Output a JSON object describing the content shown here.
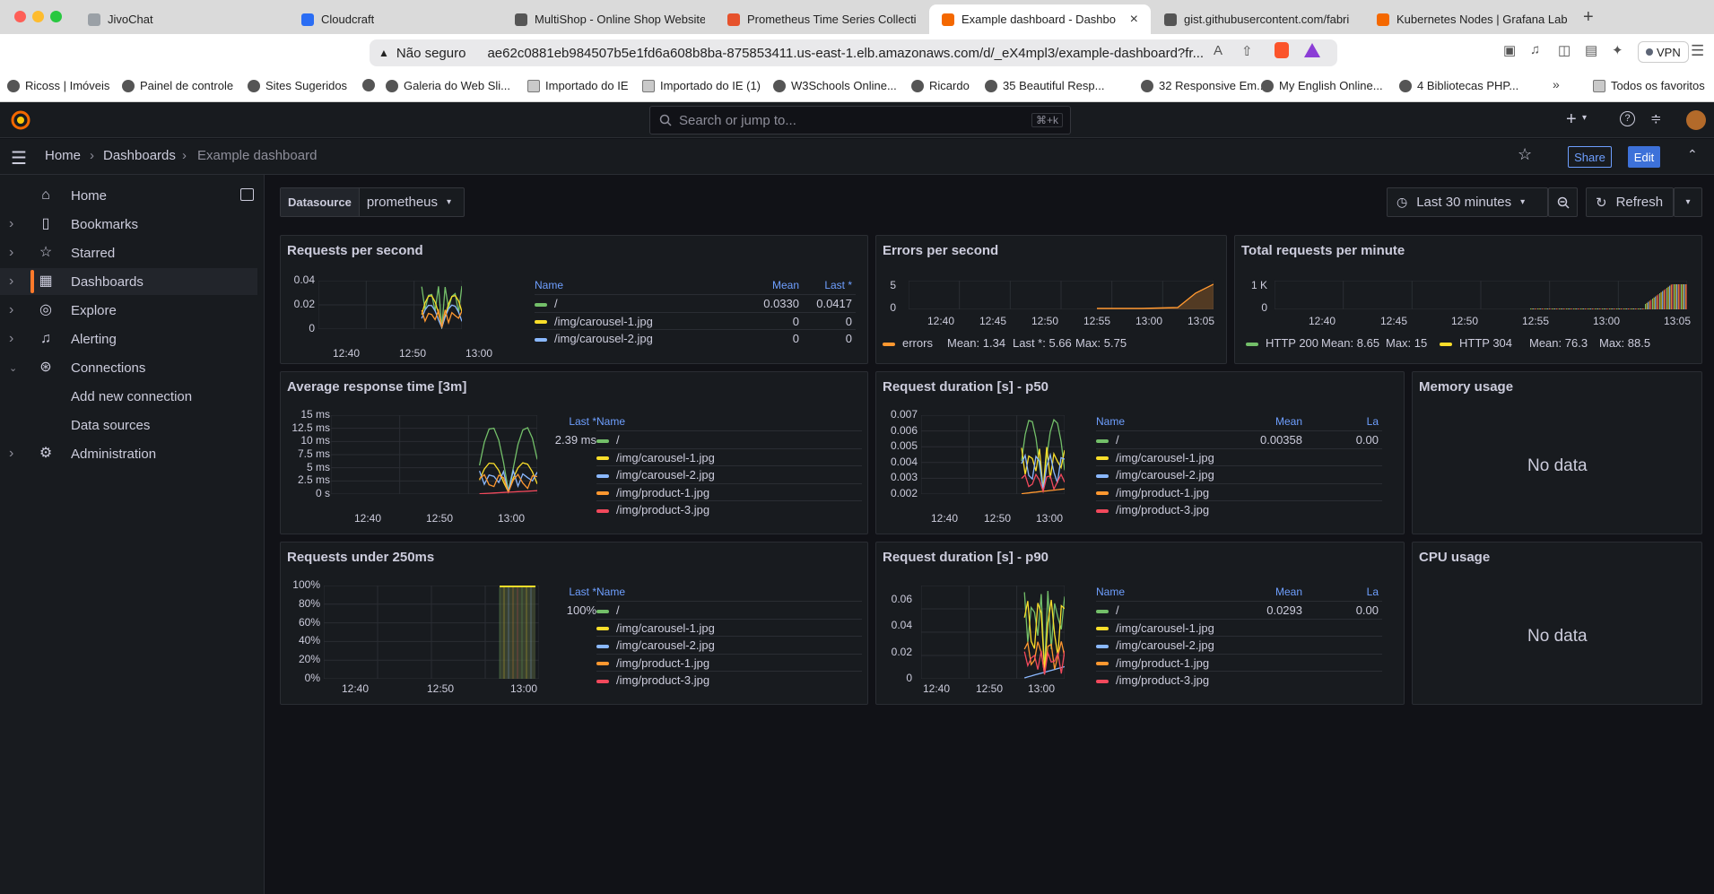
{
  "browser": {
    "tabs": [
      {
        "label": "JivoChat",
        "color": "#9aa0a6"
      },
      {
        "label": "Cloudcraft",
        "color": "#2a6df4"
      },
      {
        "label": "MultiShop - Online Shop Website",
        "color": "#555555"
      },
      {
        "label": "Prometheus Time Series Collecti",
        "color": "#e6522c"
      },
      {
        "label": "Example dashboard - Dashbo",
        "color": "#f46800"
      },
      {
        "label": "gist.githubusercontent.com/fabri",
        "color": "#555555"
      },
      {
        "label": "Kubernetes Nodes | Grafana Labs",
        "color": "#f46800"
      }
    ],
    "security_label": "Não seguro",
    "url": "ae62c0881eb984507b5e1fd6a608b8ba-875853411.us-east-1.elb.amazonaws.com/d/_eX4mpl3/example-dashboard?fr...",
    "vpn_label": "VPN",
    "bookmarks": [
      "Ricoss | Imóveis",
      "Painel de controle",
      "Sites Sugeridos",
      "",
      "Galeria do Web Sli...",
      "Importado do IE",
      "Importado do IE (1)",
      "W3Schools Online...",
      "Ricardo",
      "35 Beautiful Resp...",
      "32 Responsive Em...",
      "My English Online...",
      "4 Bibliotecas PHP...",
      "Todos os favoritos"
    ]
  },
  "grafana": {
    "search_placeholder": "Search or jump to...",
    "search_shortcut": "⌘+k",
    "breadcrumb": [
      "Home",
      "Dashboards",
      "Example dashboard"
    ],
    "share_label": "Share",
    "edit_label": "Edit",
    "sidebar": [
      {
        "label": "Home",
        "icon": "home-icon",
        "chevron": false,
        "indent": false
      },
      {
        "label": "Bookmarks",
        "icon": "bookmark-icon",
        "chevron": true,
        "indent": false
      },
      {
        "label": "Starred",
        "icon": "star-icon",
        "chevron": true,
        "indent": false
      },
      {
        "label": "Dashboards",
        "icon": "apps-icon",
        "chevron": true,
        "indent": false
      },
      {
        "label": "Explore",
        "icon": "compass-icon",
        "chevron": true,
        "indent": false
      },
      {
        "label": "Alerting",
        "icon": "bell-icon",
        "chevron": true,
        "indent": false
      },
      {
        "label": "Connections",
        "icon": "connections-icon",
        "chevron": true,
        "indent": false
      },
      {
        "label": "Add new connection",
        "icon": "",
        "chevron": false,
        "indent": true
      },
      {
        "label": "Data sources",
        "icon": "",
        "chevron": false,
        "indent": true
      },
      {
        "label": "Administration",
        "icon": "cog-icon",
        "chevron": true,
        "indent": false
      }
    ],
    "datasource_label": "Datasource",
    "datasource_value": "prometheus",
    "time_range": "Last 30 minutes",
    "refresh_label": "Refresh"
  },
  "colors": {
    "green": "#73bf69",
    "yellow": "#fade2a",
    "blue": "#8ab8ff",
    "orange": "#ff9830",
    "red": "#f2495c",
    "accent": "#ff7a2b"
  },
  "panels": {
    "rps": {
      "title": "Requests per second",
      "yticks": [
        "0.04",
        "0.02",
        "0"
      ],
      "xticks": [
        "12:40",
        "12:50",
        "13:00"
      ],
      "legend_headers": [
        "Name",
        "Mean",
        "Last *"
      ],
      "rows": [
        [
          "/",
          "0.0330",
          "0.0417"
        ],
        [
          "/img/carousel-1.jpg",
          "0",
          "0"
        ],
        [
          "/img/carousel-2.jpg",
          "0",
          "0"
        ]
      ]
    },
    "eps": {
      "title": "Errors per second",
      "yticks": [
        "5",
        "0"
      ],
      "xticks": [
        "12:40",
        "12:45",
        "12:50",
        "12:55",
        "13:00",
        "13:05"
      ],
      "legend": {
        "name": "errors",
        "mean": "Mean: 1.34",
        "last": "Last *: 5.66",
        "max": "Max: 5.75"
      }
    },
    "trpm": {
      "title": "Total requests per minute",
      "yticks": [
        "1 K",
        "0"
      ],
      "xticks": [
        "12:40",
        "12:45",
        "12:50",
        "12:55",
        "13:00",
        "13:05"
      ],
      "legend": [
        {
          "name": "HTTP 200",
          "mean": "Mean: 8.65",
          "max": "Max: 15"
        },
        {
          "name": "HTTP 304",
          "mean": "Mean: 76.3",
          "max": "Max: 88.5"
        }
      ]
    },
    "avg": {
      "title": "Average response time [3m]",
      "yticks": [
        "15 ms",
        "12.5 ms",
        "10 ms",
        "7.5 ms",
        "5 ms",
        "2.5 ms",
        "0 s"
      ],
      "xticks": [
        "12:40",
        "12:50",
        "13:00"
      ],
      "legend_headers": [
        "Name",
        "Last *"
      ],
      "rows": [
        [
          "/",
          "2.39 ms"
        ],
        [
          "/img/carousel-1.jpg",
          ""
        ],
        [
          "/img/carousel-2.jpg",
          ""
        ],
        [
          "/img/product-1.jpg",
          ""
        ],
        [
          "/img/product-3.jpg",
          ""
        ]
      ]
    },
    "p50": {
      "title": "Request duration [s] - p50",
      "yticks": [
        "0.007",
        "0.006",
        "0.005",
        "0.004",
        "0.003",
        "0.002"
      ],
      "xticks": [
        "12:40",
        "12:50",
        "13:00"
      ],
      "legend_headers": [
        "Name",
        "Mean",
        "La"
      ],
      "rows": [
        [
          "/",
          "0.00358",
          "0.00"
        ],
        [
          "/img/carousel-1.jpg",
          "",
          ""
        ],
        [
          "/img/carousel-2.jpg",
          "",
          ""
        ],
        [
          "/img/product-1.jpg",
          "",
          ""
        ],
        [
          "/img/product-3.jpg",
          "",
          ""
        ]
      ]
    },
    "mem": {
      "title": "Memory usage",
      "nodata": "No data"
    },
    "under": {
      "title": "Requests under 250ms",
      "yticks": [
        "100%",
        "80%",
        "60%",
        "40%",
        "20%",
        "0%"
      ],
      "xticks": [
        "12:40",
        "12:50",
        "13:00"
      ],
      "legend_headers": [
        "Name",
        "Last *"
      ],
      "rows": [
        [
          "/",
          "100%"
        ],
        [
          "/img/carousel-1.jpg",
          ""
        ],
        [
          "/img/carousel-2.jpg",
          ""
        ],
        [
          "/img/product-1.jpg",
          ""
        ],
        [
          "/img/product-3.jpg",
          ""
        ]
      ]
    },
    "p90": {
      "title": "Request duration [s] - p90",
      "yticks": [
        "0.06",
        "0.04",
        "0.02",
        "0"
      ],
      "xticks": [
        "12:40",
        "12:50",
        "13:00"
      ],
      "legend_headers": [
        "Name",
        "Mean",
        "La"
      ],
      "rows": [
        [
          "/",
          "0.0293",
          "0.00"
        ],
        [
          "/img/carousel-1.jpg",
          "",
          ""
        ],
        [
          "/img/carousel-2.jpg",
          "",
          ""
        ],
        [
          "/img/product-1.jpg",
          "",
          ""
        ],
        [
          "/img/product-3.jpg",
          "",
          ""
        ]
      ]
    },
    "cpu": {
      "title": "CPU usage",
      "nodata": "No data"
    }
  }
}
